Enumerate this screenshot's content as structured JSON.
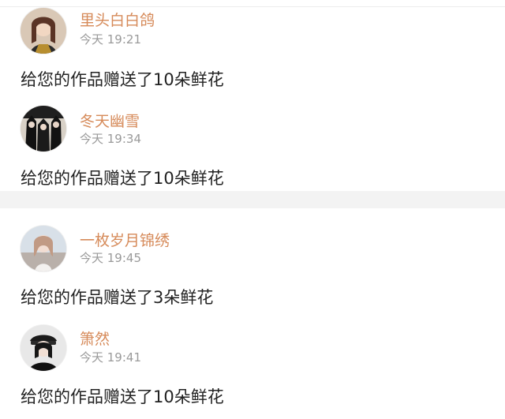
{
  "gifts": [
    {
      "name": "里头白白鸽",
      "time": "今天 19:21",
      "message": "给您的作品赠送了10朵鲜花",
      "avatar_icon": "avatar-woman-brown-hair"
    },
    {
      "name": "冬天幽雪",
      "time": "今天 19:34",
      "message": "给您的作品赠送了10朵鲜花",
      "avatar_icon": "avatar-group-dark"
    },
    {
      "name": "一枚岁月锦绣",
      "time": "今天 19:45",
      "message": "给您的作品赠送了3朵鲜花",
      "avatar_icon": "avatar-woman-light-hair"
    },
    {
      "name": "箫然",
      "time": "今天 19:41",
      "message": "给您的作品赠送了10朵鲜花",
      "avatar_icon": "avatar-woman-cap"
    }
  ],
  "colors": {
    "name": "#d68a59",
    "time": "#9a9a9a",
    "message": "#222222",
    "divider": "#f3f3f3"
  }
}
